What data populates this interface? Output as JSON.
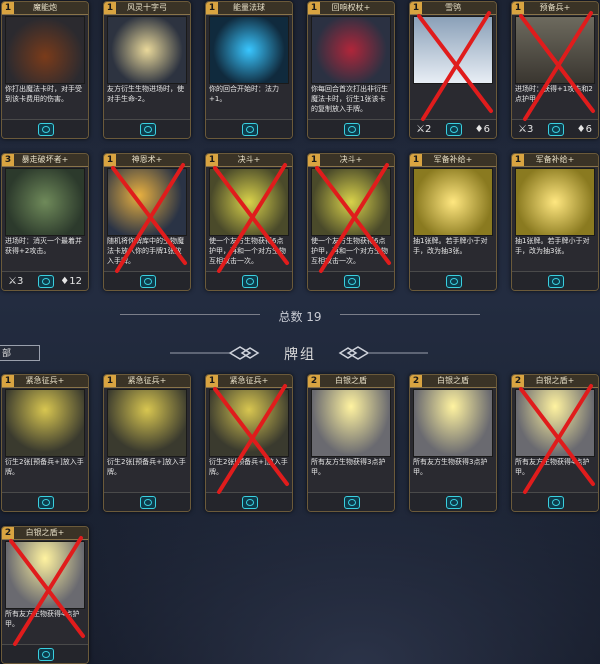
{
  "collection_cards": [
    {
      "cost": "1",
      "name": "魔能炮",
      "desc": "你打出魔法卡时，对手受到该卡费用的伤害。",
      "type": "spell",
      "art": "cannon",
      "crossed": false
    },
    {
      "cost": "1",
      "name": "风灵十字弓",
      "desc": "友方衍生生物进场时，使对手生命-2。",
      "type": "spell",
      "art": "crossbow",
      "crossed": false
    },
    {
      "cost": "1",
      "name": "能量法球",
      "desc": "你的回合开始时：法力+1。",
      "type": "spell",
      "art": "orb",
      "crossed": false
    },
    {
      "cost": "1",
      "name": "回响权杖+",
      "desc": "你每回合首次打出非衍生魔法卡时，衍生1张该卡的复制放入手牌。",
      "type": "spell",
      "art": "scepter",
      "crossed": false
    },
    {
      "cost": "1",
      "name": "雪鸮",
      "desc": "",
      "type": "creature",
      "atk": "2",
      "hp": "6",
      "art": "owl",
      "crossed": true
    },
    {
      "cost": "1",
      "name": "预备兵+",
      "desc": "进场时：获得+1攻击和2点护甲。",
      "type": "creature",
      "atk": "3",
      "hp": "6",
      "art": "soldier",
      "crossed": true
    },
    {
      "cost": "3",
      "name": "暴走破坏者+",
      "desc": "进场时：消灭一个最着并获得+2攻击。",
      "type": "creature",
      "atk": "3",
      "hp": "12",
      "art": "golem",
      "crossed": false
    },
    {
      "cost": "1",
      "name": "神恩术+",
      "desc": "随机将你牌库中的生物魔法卡放入你的手牌1张放入手牌。",
      "type": "spell",
      "art": "hero",
      "crossed": true
    },
    {
      "cost": "1",
      "name": "决斗+",
      "desc": "使一个友方生物获得6点护甲，再和一个对方生物互相攻击一次。",
      "type": "spell",
      "art": "duel",
      "crossed": true
    },
    {
      "cost": "1",
      "name": "决斗+",
      "desc": "使一个友方生物获得6点护甲，再和一个对方生物互相攻击一次。",
      "type": "spell",
      "art": "duel",
      "crossed": true
    },
    {
      "cost": "1",
      "name": "军备补给+",
      "desc": "抽1张牌。若手牌小于对手，改为抽3张。",
      "type": "spell",
      "art": "gold",
      "crossed": false
    },
    {
      "cost": "1",
      "name": "军备补给+",
      "desc": "抽1张牌。若手牌小于对手，改为抽3张。",
      "type": "spell",
      "art": "gold",
      "crossed": false
    }
  ],
  "total_label": "总数 19",
  "deck_title": "牌组",
  "filter_label": "部",
  "deck_cards": [
    {
      "cost": "1",
      "name": "紧急征兵+",
      "desc": "衍生2张[预备兵+]放入手牌。",
      "type": "spell",
      "art": "recruit",
      "crossed": false
    },
    {
      "cost": "1",
      "name": "紧急征兵+",
      "desc": "衍生2张[预备兵+]放入手牌。",
      "type": "spell",
      "art": "recruit",
      "crossed": false
    },
    {
      "cost": "1",
      "name": "紧急征兵+",
      "desc": "衍生2张[预备兵+]放入手牌。",
      "type": "spell",
      "art": "recruit",
      "crossed": true
    },
    {
      "cost": "2",
      "name": "白银之盾",
      "desc": "所有友方生物获得3点护甲。",
      "type": "spell",
      "art": "shield",
      "crossed": false
    },
    {
      "cost": "2",
      "name": "白银之盾",
      "desc": "所有友方生物获得3点护甲。",
      "type": "spell",
      "art": "shield",
      "crossed": false
    },
    {
      "cost": "2",
      "name": "白银之盾+",
      "desc": "所有友方生物获得4点护甲。",
      "type": "spell",
      "art": "shield",
      "crossed": true
    },
    {
      "cost": "2",
      "name": "白银之盾+",
      "desc": "所有友方生物获得4点护甲。",
      "type": "spell",
      "art": "shield",
      "crossed": true
    }
  ],
  "colors": {
    "cross": "#e01c1c",
    "gold": "#d9a441",
    "accent": "#3ad0e0"
  }
}
